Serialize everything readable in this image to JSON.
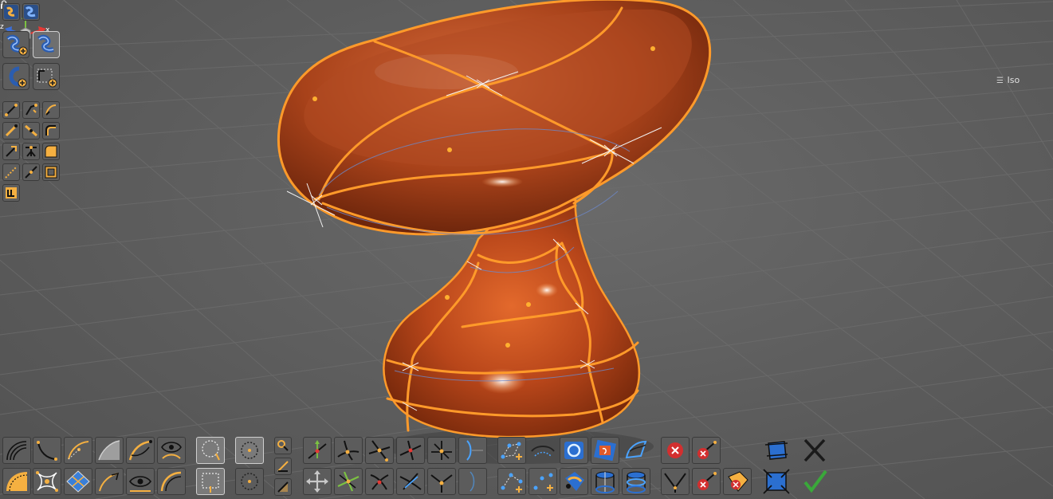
{
  "viewport": {
    "view_mode": "Iso",
    "axes": {
      "x": "x",
      "y": "y",
      "z": "z"
    },
    "colors": {
      "surface": "#c24a18",
      "surface_highlight": "#f08a4a",
      "curve_orange": "#ff9a2a",
      "background": "#5a5a5a",
      "grid": "#6e6e6e",
      "axis_x": "#e53935",
      "axis_y": "#7cc242",
      "axis_z": "#3b6fd8",
      "accent": "#f5b041",
      "confirm": "#3aa83a",
      "reject": "#d32f2f"
    }
  },
  "left_toolbar": {
    "icons": [
      "surface-mode-icon",
      "blend-surface-icon",
      "add-surface-icon",
      "surface-select-icon",
      "add-curve-icon",
      "add-loop-icon",
      "line-tool-icon",
      "polyline-tool-icon",
      "arc-tool-icon",
      "curve-edit-icon",
      "spline-tool-icon",
      "fillet-tool-icon",
      "extend-curve-icon",
      "trim-curve-icon",
      "fill-patch-icon",
      "dashed-curve-icon",
      "project-curve-icon",
      "frame-surface-icon",
      "snap-grid-icon"
    ]
  },
  "bottom_toolbar": {
    "icons": [
      "hatch-curve-icon",
      "arc-curve-icon",
      "bezier-curve-icon",
      "sweep-surface-icon",
      "loft-curve-icon",
      "eye-curve-icon",
      "fill-corner-icon",
      "star-points-icon",
      "diamond-transform-icon",
      "curve-arrow-icon",
      "eye-hide-icon",
      "shell-curve-icon",
      "lasso-select-icon",
      "circle-select-icon",
      "rect-select-icon",
      "sphere-select-icon",
      "vertex-select-icon",
      "edge-select-icon",
      "face-select-icon",
      "move-vertex-icon",
      "cross-vertex-icon",
      "star-vertex-icon",
      "split-vertex-icon",
      "join-vertex-icon",
      "bracket-icon",
      "move-gizmo-icon",
      "green-star-icon",
      "rotate-vertex-icon",
      "connect-vertex-icon",
      "corner-vertex-icon",
      "bracket-disabled-icon",
      "point-network-icon",
      "dots-network-icon",
      "rotate-patch-icon",
      "face-patch-icon",
      "lens-patch-icon",
      "flip-patch-icon",
      "blue-dots-icon",
      "tilt-patch-icon",
      "cylinder-patch-icon",
      "cylinder-ring-icon",
      "delete-circle-icon",
      "delete-curve-icon",
      "split-curve-icon",
      "delete-point-icon",
      "delete-patch-icon",
      "dimension-box-icon",
      "cancel-icon",
      "frame-box-icon",
      "confirm-icon"
    ]
  }
}
